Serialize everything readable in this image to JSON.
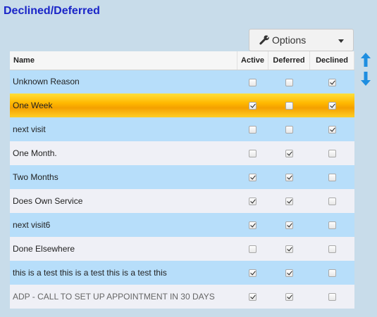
{
  "page": {
    "title": "Declined/Deferred"
  },
  "toolbar": {
    "options_label": "Options",
    "options_icon": "wrench-icon"
  },
  "grid": {
    "columns": {
      "name": "Name",
      "active": "Active",
      "deferred": "Deferred",
      "declined": "Declined"
    },
    "selected_row": 1,
    "rows": [
      {
        "name": "Unknown Reason",
        "active": false,
        "deferred": false,
        "declined": true
      },
      {
        "name": "One Week",
        "active": true,
        "deferred": false,
        "declined": true
      },
      {
        "name": "next visit",
        "active": false,
        "deferred": false,
        "declined": true
      },
      {
        "name": "One Month.",
        "active": false,
        "deferred": true,
        "declined": false
      },
      {
        "name": "Two Months",
        "active": true,
        "deferred": true,
        "declined": false
      },
      {
        "name": "Does Own Service",
        "active": true,
        "deferred": true,
        "declined": false
      },
      {
        "name": "next visit6",
        "active": true,
        "deferred": true,
        "declined": false
      },
      {
        "name": "Done Elsewhere",
        "active": false,
        "deferred": true,
        "declined": false
      },
      {
        "name": "this is a test this is a test this is a test this",
        "active": true,
        "deferred": true,
        "declined": false
      },
      {
        "name": "ADP - CALL TO SET UP APPOINTMENT IN 30 DAYS",
        "active": true,
        "deferred": true,
        "declined": false
      }
    ]
  },
  "side_controls": {
    "up_icon": "arrow-up-icon",
    "down_icon": "arrow-down-icon"
  },
  "colors": {
    "title": "#1a25c8",
    "row_alt": "#b7defa",
    "row": "#eff0f6",
    "selected": "#ffb800",
    "arrow": "#1e8ee0"
  }
}
